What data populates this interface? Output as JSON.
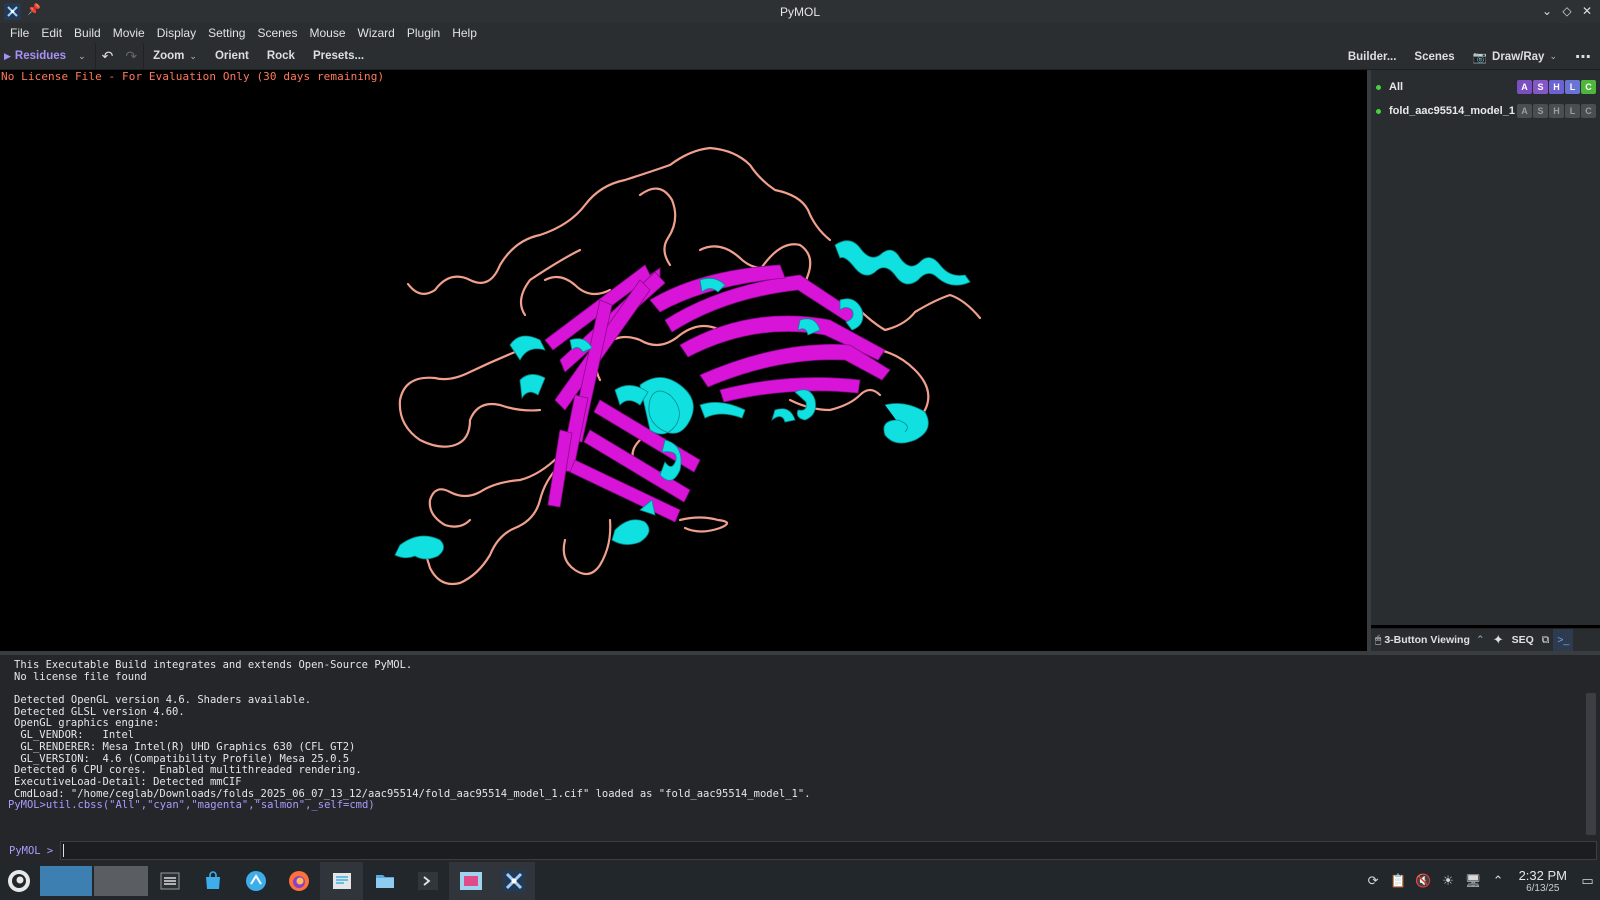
{
  "window": {
    "title": "PyMOL"
  },
  "menu": [
    "File",
    "Edit",
    "Build",
    "Movie",
    "Display",
    "Setting",
    "Scenes",
    "Mouse",
    "Wizard",
    "Plugin",
    "Help"
  ],
  "toolbar": {
    "residues": "Residues",
    "zoom": "Zoom",
    "orient": "Orient",
    "rock": "Rock",
    "presets": "Presets...",
    "builder": "Builder...",
    "scenes": "Scenes",
    "draw_ray": "Draw/Ray"
  },
  "viewport": {
    "license_text": "No License File - For Evaluation Only (30 days remaining)",
    "colors": {
      "helix": "#14e0e0",
      "sheet": "#e010e0",
      "loop": "#f4a08a"
    }
  },
  "objects": [
    {
      "name": "All",
      "buttons": [
        "A",
        "S",
        "H",
        "L",
        "C"
      ]
    },
    {
      "name": "fold_aac95514_model_1",
      "buttons": [
        "A",
        "S",
        "H",
        "L",
        "C"
      ]
    }
  ],
  "panel_footer": {
    "mouse_mode": "3-Button Viewing",
    "seq": "SEQ"
  },
  "console": {
    "lines": [
      "This Executable Build integrates and extends Open-Source PyMOL.",
      "No license file found",
      "",
      "Detected OpenGL version 4.6. Shaders available.",
      "Detected GLSL version 4.60.",
      "OpenGL graphics engine:",
      " GL_VENDOR:   Intel",
      " GL_RENDERER: Mesa Intel(R) UHD Graphics 630 (CFL GT2)",
      " GL_VERSION:  4.6 (Compatibility Profile) Mesa 25.0.5",
      "Detected 6 CPU cores.  Enabled multithreaded rendering.",
      "ExecutiveLoad-Detail: Detected mmCIF",
      "CmdLoad: \"/home/ceglab/Downloads/folds_2025_06_07_13_12/aac95514/fold_aac95514_model_1.cif\" loaded as \"fold_aac95514_model_1\"."
    ],
    "last_command": "PyMOL>util.cbss(\"All\",\"cyan\",\"magenta\",\"salmon\",_self=cmd)",
    "prompt": "PyMOL >",
    "input_value": ""
  },
  "taskbar": {
    "clock_time": "2:32 PM",
    "clock_date": "6/13/25"
  }
}
